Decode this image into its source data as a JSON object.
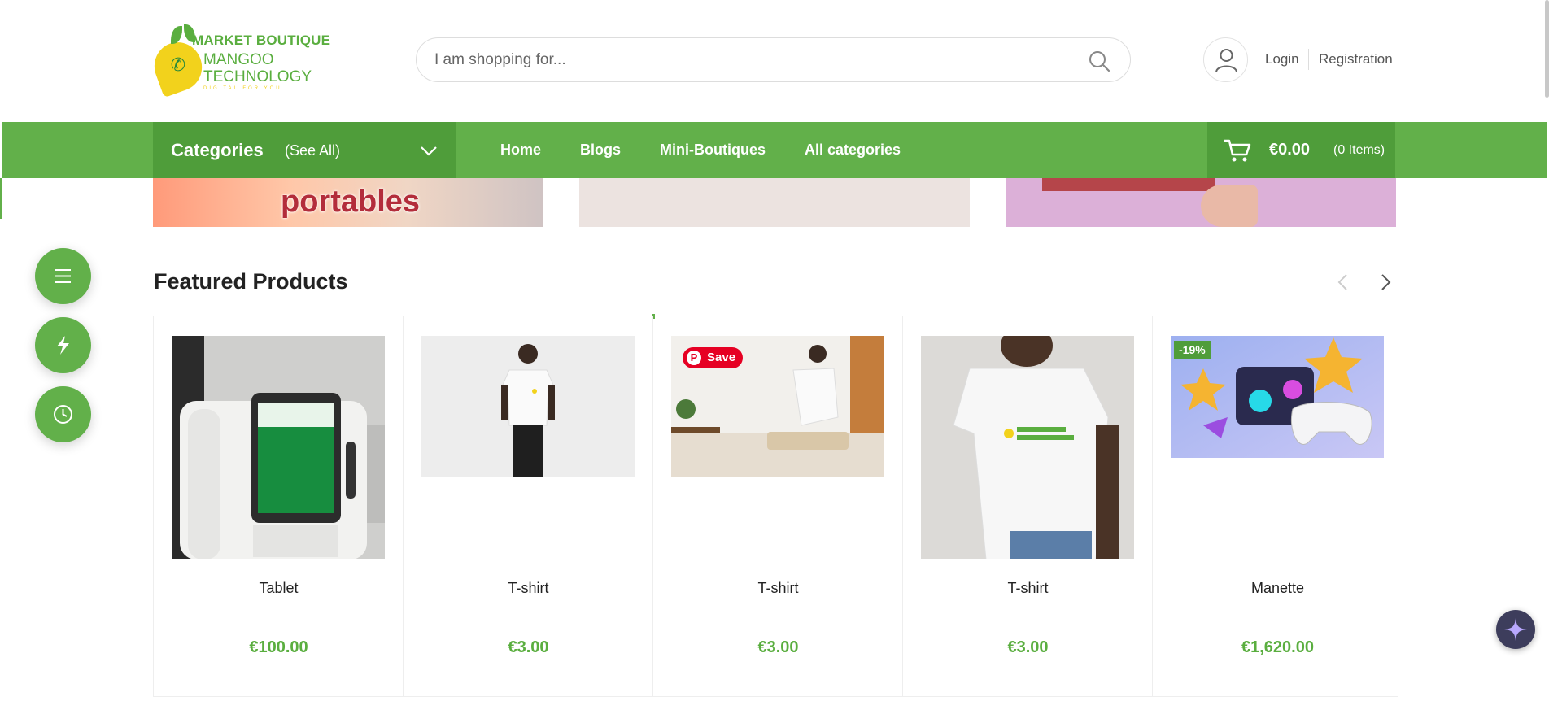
{
  "logo": {
    "line1": "MARKET BOUTIQUE",
    "line2": "MANGOO",
    "line3": "TECHNOLOGY",
    "tagline": "DIGITAL FOR YOU"
  },
  "search": {
    "placeholder": "I am shopping for..."
  },
  "account": {
    "login": "Login",
    "register": "Registration"
  },
  "nav": {
    "categories_label": "Categories",
    "see_all": "(See All)",
    "links": [
      "Home",
      "Blogs",
      "Mini-Boutiques",
      "All categories"
    ]
  },
  "cart": {
    "amount": "€0.00",
    "items": "(0 Items)"
  },
  "banners": {
    "first_text": "portables"
  },
  "featured": {
    "title": "Featured Products",
    "products": [
      {
        "name": "Tablet",
        "price": "€100.00",
        "badge": ""
      },
      {
        "name": "T-shirt",
        "price": "€3.00",
        "badge": ""
      },
      {
        "name": "T-shirt",
        "price": "€3.00",
        "badge": "Save"
      },
      {
        "name": "T-shirt",
        "price": "€3.00",
        "badge": ""
      },
      {
        "name": "Manette",
        "price": "€1,620.00",
        "badge": "-19%"
      }
    ]
  },
  "icons": {
    "search": "search-icon",
    "user": "user-icon",
    "cart": "cart-icon",
    "menu": "menu-icon",
    "flash": "lightning-icon",
    "history": "clock-icon",
    "ai": "sparkle-icon"
  },
  "colors": {
    "brand_green": "#62b04a",
    "dark_green": "#4f9d3a",
    "price_green": "#5aae3f",
    "pinterest_red": "#e60023"
  }
}
